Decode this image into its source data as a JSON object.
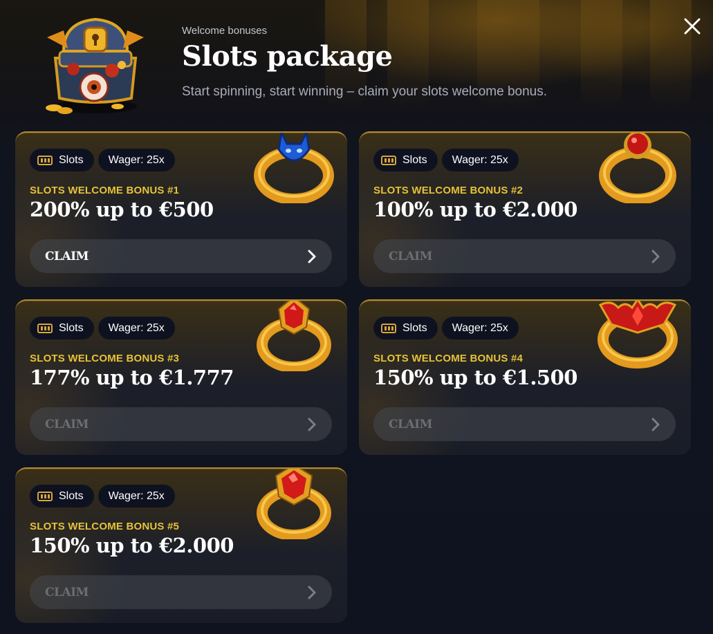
{
  "colors": {
    "accent_gold": "#e6c238",
    "card_border": "#b98b2a",
    "chip_bg": "#0e1220",
    "page_bg": "#0f1320"
  },
  "header": {
    "eyebrow": "Welcome bonuses",
    "title": "Slots package",
    "subtitle": "Start spinning, start winning – claim your slots welcome bonus.",
    "chest_icon": "treasure-chest-icon",
    "close_icon": "close-icon"
  },
  "cards": [
    {
      "chip_category": "Slots",
      "chip_wager": "Wager: 25x",
      "label": "SLOTS WELCOME BONUS #1",
      "offer": "200% up to €500",
      "claim": "CLAIM",
      "ring": "blue-demon-ring-icon",
      "active": true
    },
    {
      "chip_category": "Slots",
      "chip_wager": "Wager: 25x",
      "label": "SLOTS WELCOME BONUS #2",
      "offer": "100% up to €2.000",
      "claim": "CLAIM",
      "ring": "red-orb-ring-icon",
      "active": false
    },
    {
      "chip_category": "Slots",
      "chip_wager": "Wager: 25x",
      "label": "SLOTS WELCOME BONUS #3",
      "offer": "177% up to €1.777",
      "claim": "CLAIM",
      "ring": "red-gem-ring-icon",
      "active": false
    },
    {
      "chip_category": "Slots",
      "chip_wager": "Wager: 25x",
      "label": "SLOTS WELCOME BONUS #4",
      "offer": "150% up to €1.500",
      "claim": "CLAIM",
      "ring": "bat-wing-ring-icon",
      "active": false
    },
    {
      "chip_category": "Slots",
      "chip_wager": "Wager: 25x",
      "label": "SLOTS WELCOME BONUS #5",
      "offer": "150% up to €2.000",
      "claim": "CLAIM",
      "ring": "ruby-ring-icon",
      "active": false
    }
  ]
}
